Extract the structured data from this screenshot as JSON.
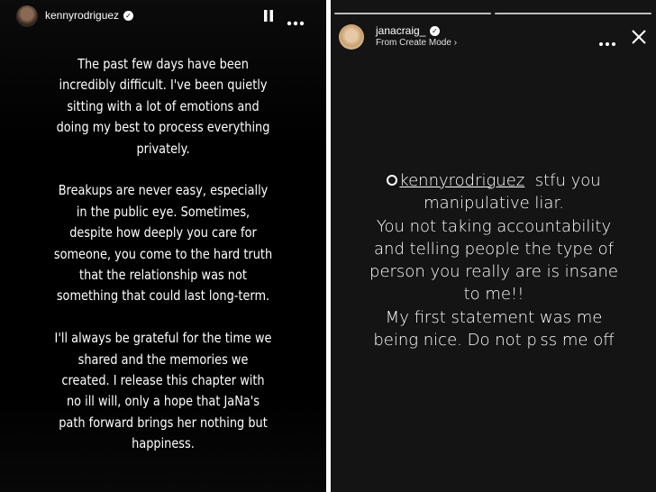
{
  "left_story": {
    "username": "kennyrodriguez",
    "paragraphs": [
      "The past few days have been incredibly difficult. I've been quietly sitting with a lot of emotions and doing my best to process everything privately.",
      "Breakups are never easy, especially in the public eye. Sometimes, despite how deeply you care for someone, you come to the hard truth that the relationship was not something that could last long-term.",
      "I'll always be grateful for the time we shared and the memories we created. I release this chapter with no ill will, only a hope that JaNa's path forward brings her nothing but happiness."
    ],
    "icons": [
      "pause-icon",
      "more-icon"
    ]
  },
  "right_story": {
    "username": "janacraig_",
    "subtitle": "From Create Mode",
    "mention": "kennyrodriguez",
    "message_after_mention": "stfu you manipulative liar.",
    "lines": [
      "You not taking accountability",
      "and telling people the type of",
      "person you really are is insane",
      "to me!!",
      "My first statement was me",
      "being nice. Do not p ss me off"
    ],
    "icons": [
      "more-icon",
      "close-icon"
    ]
  },
  "colors": {
    "background": "#000000",
    "right_background": "#141414",
    "text": "#ffffff",
    "progress": "#bdbdbd"
  }
}
